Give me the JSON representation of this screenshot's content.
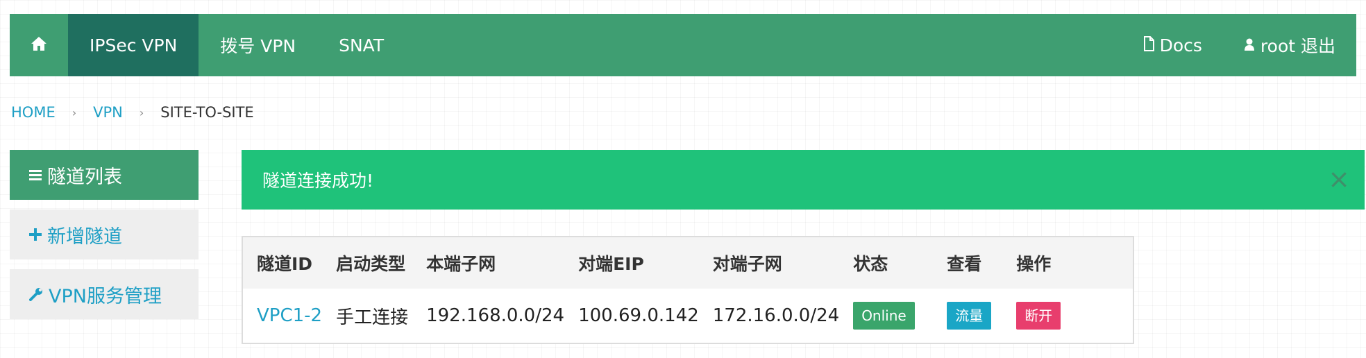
{
  "nav": {
    "home_icon": "home-icon",
    "items": [
      {
        "label": "IPSec VPN",
        "active": true
      },
      {
        "label": "拨号 VPN",
        "active": false
      },
      {
        "label": "SNAT",
        "active": false
      }
    ],
    "docs_label": "Docs",
    "user_label": "root 退出"
  },
  "breadcrumb": {
    "items": [
      "HOME",
      "VPN"
    ],
    "separator": "›",
    "current": "SITE-TO-SITE"
  },
  "sidebar": {
    "items": [
      {
        "label": "隧道列表",
        "icon": "list-icon",
        "active": true
      },
      {
        "label": "新增隧道",
        "icon": "plus-icon",
        "active": false
      },
      {
        "label": "VPN服务管理",
        "icon": "wrench-icon",
        "active": false
      }
    ]
  },
  "alert": {
    "message": "隧道连接成功!",
    "close": "×"
  },
  "table": {
    "headers": [
      "隧道ID",
      "启动类型",
      "本端子网",
      "对端EIP",
      "对端子网",
      "状态",
      "查看",
      "操作"
    ],
    "rows": [
      {
        "id": "VPC1-2",
        "start_type": "手工连接",
        "local_subnet": "192.168.0.0/24",
        "peer_eip": "100.69.0.142",
        "peer_subnet": "172.16.0.0/24",
        "status": "Online",
        "view": "流量",
        "action": "断开"
      }
    ]
  },
  "colors": {
    "nav_bg": "#3f9e72",
    "nav_active": "#1f6f5f",
    "link": "#1e9fc5",
    "alert_bg": "#1fc27a",
    "status_online": "#3aa56b",
    "view_button": "#1aa6c6",
    "action_button": "#e83e6d"
  }
}
